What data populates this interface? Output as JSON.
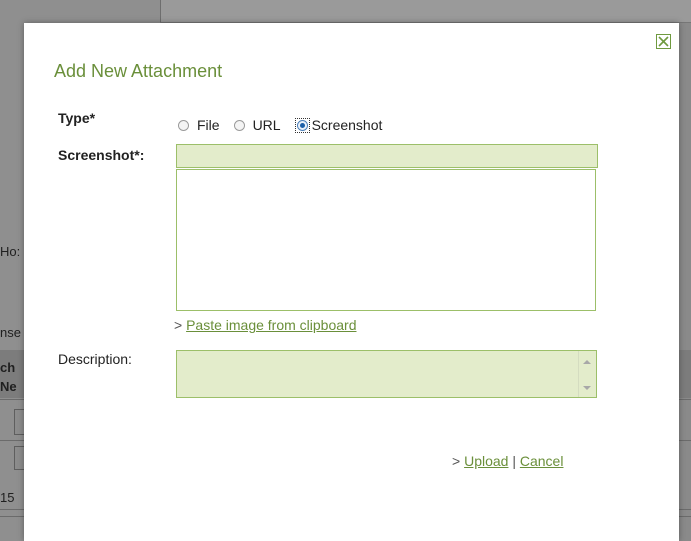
{
  "background": {
    "fragments": [
      "Ho:",
      "nse",
      "ch",
      "Ne",
      "15"
    ]
  },
  "dialog": {
    "title": "Add New Attachment",
    "close_icon": "close-icon",
    "type_label": "Type*",
    "type_options": [
      {
        "label": "File",
        "selected": false
      },
      {
        "label": "URL",
        "selected": false
      },
      {
        "label": "Screenshot",
        "selected": true
      }
    ],
    "screenshot_label": "Screenshot*:",
    "screenshot_value": "",
    "paste_prefix": ">",
    "paste_link": "Paste image from clipboard",
    "description_label": "Description:",
    "description_value": "",
    "actions_prefix": ">",
    "upload_label": "Upload",
    "separator": "|",
    "cancel_label": "Cancel"
  },
  "colors": {
    "accent": "#6a8f3a",
    "field_bg": "#e3eccb",
    "field_border": "#9cbf69",
    "overlay": "#8a8a8a"
  }
}
